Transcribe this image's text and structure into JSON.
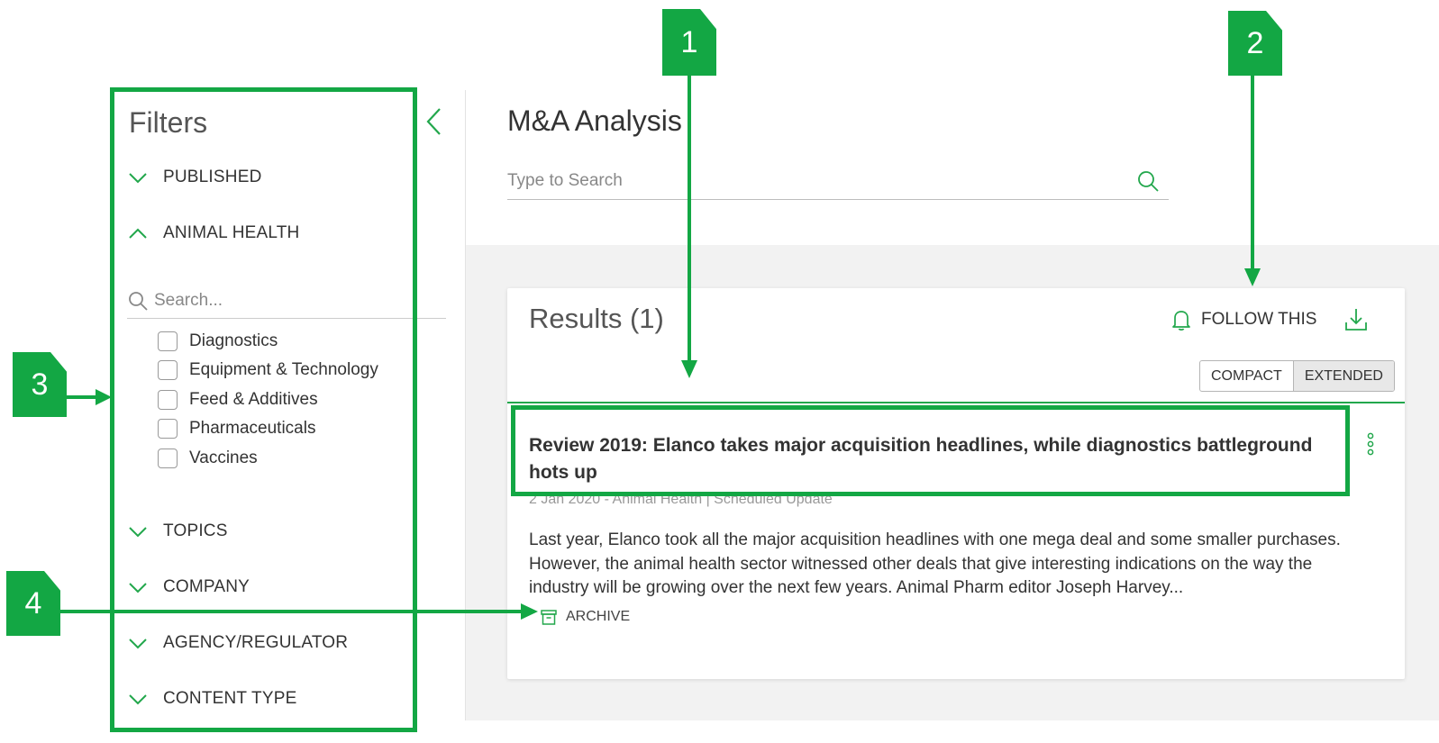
{
  "filters": {
    "title": "Filters",
    "facets": [
      {
        "label": "PUBLISHED",
        "expanded": false
      },
      {
        "label": "ANIMAL HEALTH",
        "expanded": true
      },
      {
        "label": "TOPICS",
        "expanded": false
      },
      {
        "label": "COMPANY",
        "expanded": false
      },
      {
        "label": "AGENCY/REGULATOR",
        "expanded": false
      },
      {
        "label": "CONTENT TYPE",
        "expanded": false
      }
    ],
    "search_placeholder": "Search...",
    "options": [
      "Diagnostics",
      "Equipment & Technology",
      "Feed & Additives",
      "Pharmaceuticals",
      "Vaccines"
    ]
  },
  "page": {
    "title": "M&A Analysis",
    "search_placeholder": "Type to Search"
  },
  "results": {
    "title": "Results (1)",
    "follow_label": "FOLLOW THIS",
    "view_compact": "COMPACT",
    "view_extended": "EXTENDED",
    "active_view": "EXTENDED"
  },
  "article": {
    "title": "Review 2019: Elanco takes major acquisition headlines, while diagnostics battleground hots up",
    "meta": "2 Jan 2020 - Animal Health | Scheduled Update",
    "excerpt": "Last year, Elanco took all the major acquisition headlines with one mega deal and some smaller purchases. However, the animal health sector witnessed other deals that give interesting indications on the way the industry will be growing over the next few years. Animal Pharm editor Joseph Harvey...",
    "archive_label": "ARCHIVE"
  },
  "callouts": [
    "1",
    "2",
    "3",
    "4"
  ],
  "colors": {
    "accent": "#22a74c",
    "annotation": "#13a744"
  },
  "icons": [
    "chevron-left-icon",
    "chevron-down-icon",
    "chevron-up-icon",
    "search-icon",
    "bell-icon",
    "download-icon",
    "kebab-icon",
    "archive-icon"
  ]
}
